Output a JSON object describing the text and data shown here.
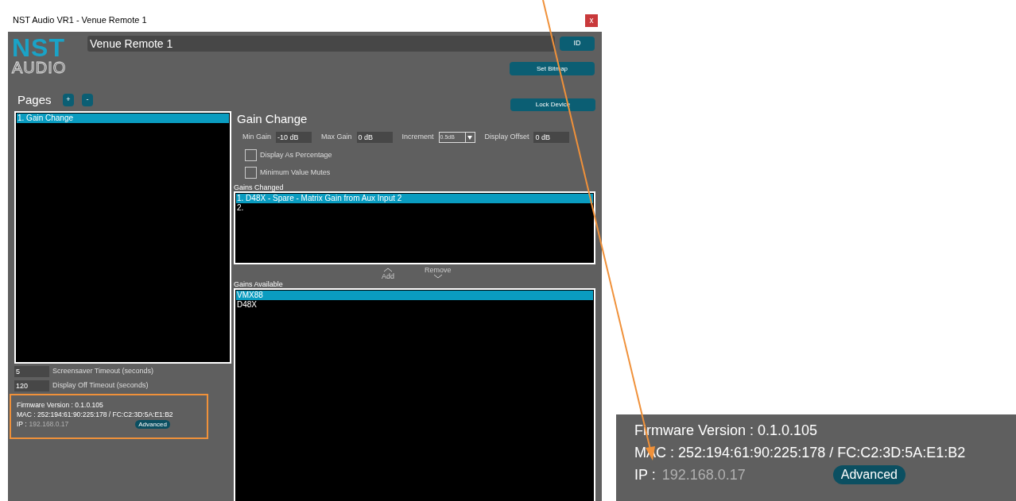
{
  "window": {
    "title": "NST Audio VR1 - Venue Remote 1",
    "close": "x"
  },
  "logo": {
    "top": "NST",
    "bottom": "AUDIO"
  },
  "device_name": "Venue Remote 1",
  "id_button": "ID",
  "set_bitmap_button": "Set Bitmap",
  "lock_device_button": "Lock Device",
  "pages": {
    "label": "Pages",
    "add": "+",
    "remove": "-",
    "items": [
      {
        "label": "1. Gain Change",
        "selected": true
      }
    ]
  },
  "page_detail": {
    "title": "Gain Change",
    "fields": [
      {
        "label": "Min Gain",
        "value": "-10 dB",
        "kind": "text"
      },
      {
        "label": "Max Gain",
        "value": "0 dB",
        "kind": "text"
      },
      {
        "label": "Increment",
        "value": "0.5dB",
        "kind": "dropdown"
      },
      {
        "label": "Display Offset",
        "value": "0 dB",
        "kind": "text"
      }
    ],
    "options": [
      {
        "label": "Display As Percentage",
        "checked": false
      },
      {
        "label": "Minimum Value Mutes",
        "checked": false
      }
    ],
    "gains_changed": {
      "label": "Gains Changed",
      "items": [
        {
          "label": "1. D48X - Spare - Matrix Gain from Aux Input 2",
          "selected": true
        },
        {
          "label": "2.",
          "selected": false
        }
      ]
    },
    "add": "Add",
    "remove": "Remove",
    "gains_available": {
      "label": "Gains Available",
      "items": [
        {
          "label": "VMX88",
          "selected": true
        },
        {
          "label": "D48X",
          "selected": false
        }
      ]
    }
  },
  "timeouts": [
    {
      "value": "5",
      "label": "Screensaver Timeout (seconds)"
    },
    {
      "value": "120",
      "label": "Display Off Timeout (seconds)"
    }
  ],
  "device_info": {
    "firmware": "Firmware Version : 0.1.0.105",
    "mac": "MAC : 252:194:61:90:225:178 / FC:C2:3D:5A:E1:B2",
    "ip_label": "IP :",
    "ip": "192.168.0.17",
    "advanced": "Advanced"
  },
  "zoomed_inset": {
    "firmware": "Firmware Version : 0.1.0.105",
    "mac": "MAC : 252:194:61:90:225:178 / FC:C2:3D:5A:E1:B2",
    "ip_label": "IP :",
    "ip": "192.168.0.17",
    "advanced": "Advanced"
  }
}
